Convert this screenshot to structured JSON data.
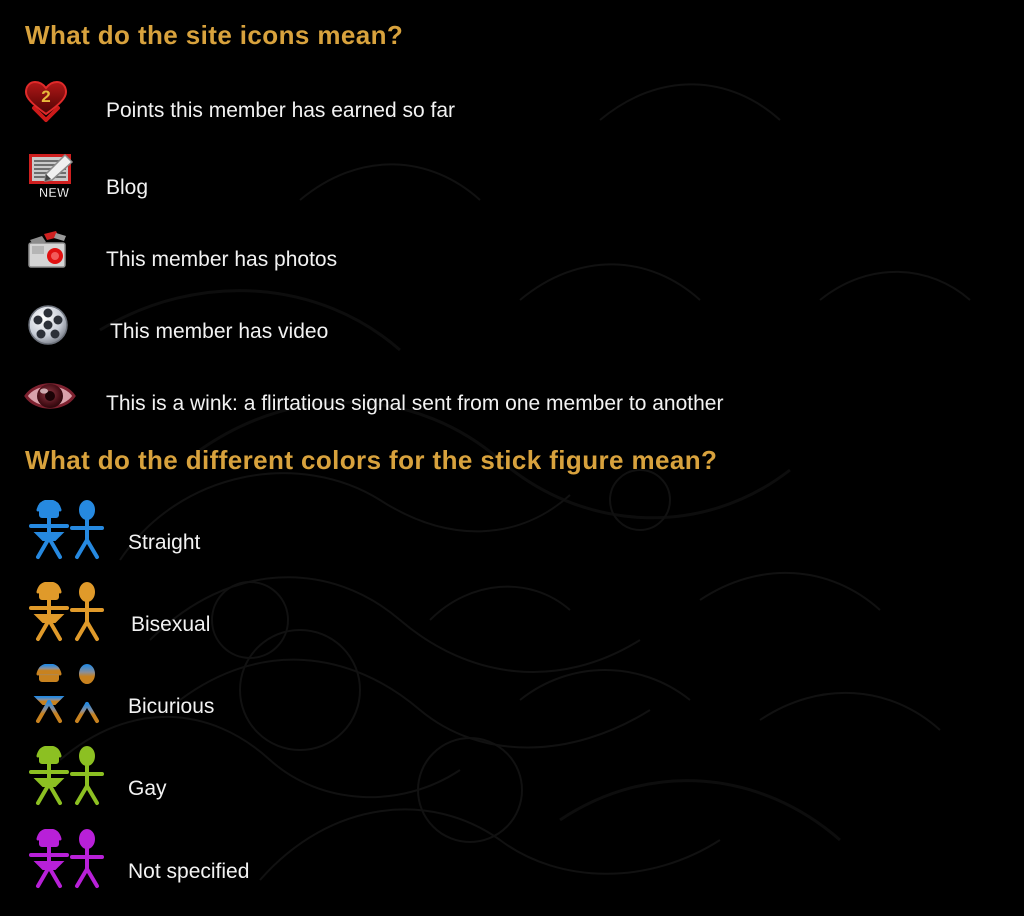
{
  "page": {
    "background_color": "#000000",
    "heading_color": "#d8a23d",
    "text_color": "#f2f2f2"
  },
  "sections": [
    {
      "id": "site-icons",
      "heading": "What do the site icons mean?",
      "items": [
        {
          "icon": "heart-points-icon",
          "badge": "2",
          "label": "Points this member has earned so far"
        },
        {
          "icon": "blog-notepad-icon",
          "badge": "NEW",
          "label": "Blog"
        },
        {
          "icon": "camera-photos-icon",
          "badge": "",
          "label": "This member has photos"
        },
        {
          "icon": "film-reel-video-icon",
          "badge": "",
          "label": "This member has video"
        },
        {
          "icon": "eye-wink-icon",
          "badge": "",
          "label": "This is a wink: a flirtatious signal sent from one member to another"
        }
      ]
    },
    {
      "id": "stick-figure-colors",
      "heading": "What do the different colors for the stick figure mean?",
      "items": [
        {
          "icon": "stick-figure-pair-icon",
          "label": "Straight",
          "color_top": "#2689e0",
          "color_bottom": "#2689e0"
        },
        {
          "icon": "stick-figure-pair-icon",
          "label": "Bisexual",
          "color_top": "#e09a2a",
          "color_bottom": "#e09a2a"
        },
        {
          "icon": "stick-figure-pair-icon",
          "label": "Bicurious",
          "color_top": "#2689e0",
          "color_bottom": "#c8821f"
        },
        {
          "icon": "stick-figure-pair-icon",
          "label": "Gay",
          "color_top": "#8cc022",
          "color_bottom": "#8cc022"
        },
        {
          "icon": "stick-figure-pair-icon",
          "label": "Not specified",
          "color_top": "#b820d8",
          "color_bottom": "#b820d8"
        }
      ]
    }
  ]
}
